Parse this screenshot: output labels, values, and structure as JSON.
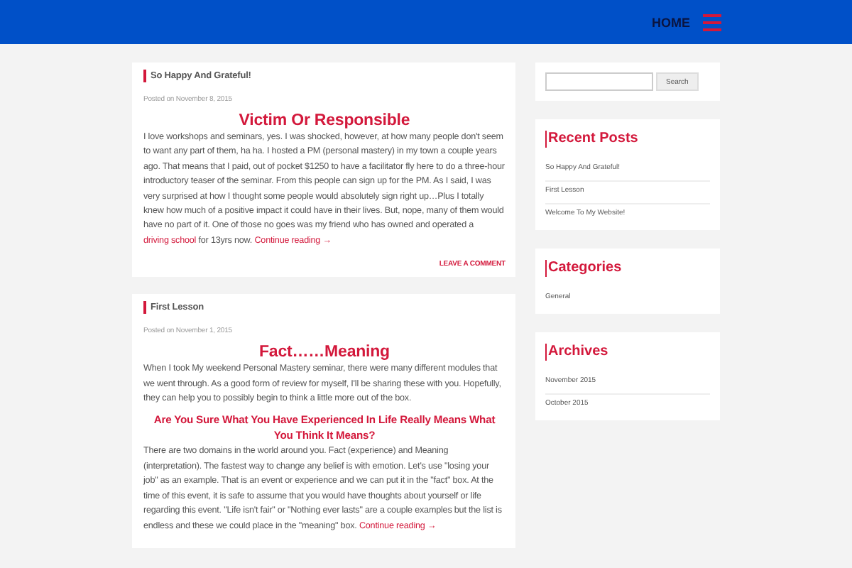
{
  "header": {
    "nav_label": "HOME"
  },
  "posts": [
    {
      "section_title": "So Happy And Grateful!",
      "date": "Posted on November 8, 2015",
      "title": "Victim Or Responsible",
      "blocks": [
        {
          "kind": "paragraph",
          "segments": [
            {
              "kind": "text",
              "text": "I love workshops and seminars, yes. I was shocked, however, at how many people don't seem to want any part of them, ha ha. I hosted a PM (personal mastery) in my town a couple years ago. That means that I paid, out of pocket $1250 to have a facilitator fly here to do a three-hour introductory teaser of the seminar. From this people can sign up for the PM. As I said, I was very surprised at how I thought some people would absolutely sign right up…Plus I totally knew how much of a positive impact it could have in their lives. But, nope, many of them would have no part of it. One of those no goes was my friend who has owned and operated a "
            },
            {
              "kind": "link",
              "text": "driving school"
            },
            {
              "kind": "text",
              "text": " for 13yrs now. "
            },
            {
              "kind": "link",
              "text": "Continue reading →"
            }
          ]
        }
      ],
      "comment_link": "LEAVE A COMMENT"
    },
    {
      "section_title": "First Lesson",
      "date": "Posted on November 1, 2015",
      "title": "Fact……Meaning",
      "blocks": [
        {
          "kind": "paragraph",
          "segments": [
            {
              "kind": "text",
              "text": "When I took My weekend Personal Mastery seminar, there were many different modules that we went through. As a good form of review for myself, I'll be sharing these with you. Hopefully, they can help you to possibly begin to think a little more out of the box."
            }
          ]
        },
        {
          "kind": "heading",
          "text": "Are You Sure What You Have Experienced In Life Really Means What You Think It Means?"
        },
        {
          "kind": "paragraph",
          "segments": [
            {
              "kind": "text",
              "text": "There are two domains in the world around you. Fact (experience) and Meaning (interpretation). The fastest way to change any belief is with emotion. Let's use \"losing your job\" as an example. That is an event or experience and we can put it in the \"fact\" box. At the time of this event, it is safe to assume that you would have thoughts about yourself or life regarding this event. \"Life isn't fair\" or \"Nothing ever lasts\" are a couple examples but the list is endless and these we could place in the \"meaning\" box. "
            },
            {
              "kind": "link",
              "text": "Continue reading →"
            }
          ]
        }
      ]
    }
  ],
  "sidebar": {
    "search_button": "Search",
    "widgets": [
      {
        "title": "Recent Posts",
        "items": [
          "So Happy And Grateful!",
          "First Lesson",
          "Welcome To My Website!"
        ]
      },
      {
        "title": "Categories",
        "items": [
          "General"
        ]
      },
      {
        "title": "Archives",
        "items": [
          "November 2015",
          "October 2015"
        ]
      }
    ]
  }
}
